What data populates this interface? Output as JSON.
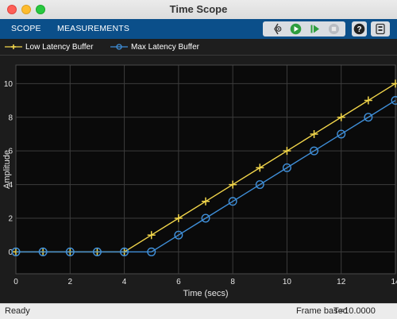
{
  "window": {
    "title": "Time Scope"
  },
  "tabs": [
    {
      "label": "SCOPE"
    },
    {
      "label": "MEASUREMENTS"
    }
  ],
  "toolbar": {
    "icons": [
      "settings-cursor-icon",
      "run-icon",
      "step-forward-icon",
      "stop-icon",
      "help-icon",
      "more-icon"
    ],
    "help_glyph": "?",
    "more_glyph": "⋮"
  },
  "legend": [
    {
      "label": "Low Latency Buffer",
      "color": "#f2d64b",
      "marker": "plus"
    },
    {
      "label": "Max Latency Buffer",
      "color": "#3f8fd9",
      "marker": "circle"
    }
  ],
  "chart_data": {
    "type": "line",
    "xlabel": "Time (secs)",
    "ylabel": "Amplitude",
    "xlim": [
      0,
      14
    ],
    "ylim": [
      -1.3,
      11.1
    ],
    "xticks": [
      0,
      2,
      4,
      6,
      8,
      10,
      12,
      14
    ],
    "yticks": [
      0,
      2,
      4,
      6,
      8,
      10
    ],
    "grid": true,
    "legend_position": "top",
    "series": [
      {
        "name": "Low Latency Buffer",
        "color": "#f2d64b",
        "marker": "plus",
        "x": [
          0,
          1,
          2,
          3,
          4,
          5,
          6,
          7,
          8,
          9,
          10,
          11,
          12,
          13,
          14
        ],
        "y": [
          0,
          0,
          0,
          0,
          0,
          1,
          2,
          3,
          4,
          5,
          6,
          7,
          8,
          9,
          10
        ]
      },
      {
        "name": "Max Latency Buffer",
        "color": "#3f8fd9",
        "marker": "circle",
        "x": [
          0,
          1,
          2,
          3,
          4,
          5,
          6,
          7,
          8,
          9,
          10,
          11,
          12,
          13,
          14
        ],
        "y": [
          0,
          0,
          0,
          0,
          0,
          0,
          1,
          2,
          3,
          4,
          5,
          6,
          7,
          8,
          9
        ]
      }
    ]
  },
  "status": {
    "left": "Ready",
    "mode": "Frame based",
    "time": "T=10.0000"
  }
}
